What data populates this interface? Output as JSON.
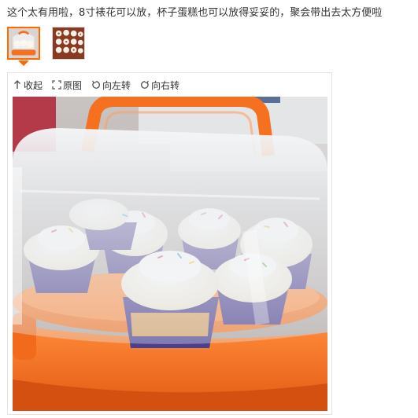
{
  "review": {
    "text": "这个太有用啦，8寸裱花可以放，杯子蛋糕也可以放得妥妥的，聚会带出去太方便啦"
  },
  "thumbnails": [
    {
      "name": "thumbnail-cupcake-carrier",
      "selected": true
    },
    {
      "name": "thumbnail-cupcakes-tray",
      "selected": false
    }
  ],
  "toolbar": {
    "collapse_label": "收起",
    "original_label": "原图",
    "rotate_left_label": "向左转",
    "rotate_right_label": "向右转"
  },
  "colors": {
    "accent": "#ff6a00",
    "carrier_orange": "#f5701f",
    "frosting": "#fbf7ee",
    "liner": "#4b3f8f"
  }
}
